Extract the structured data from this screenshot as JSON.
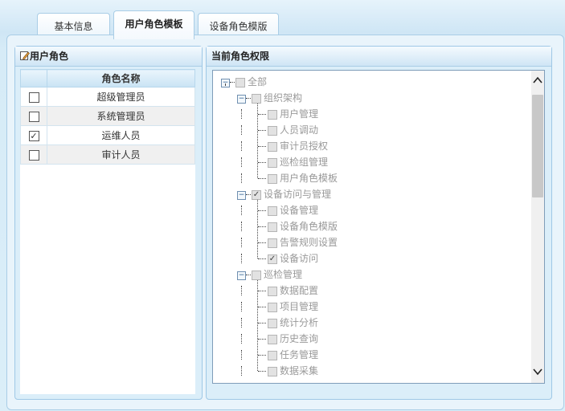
{
  "tabs": [
    {
      "label": "基本信息"
    },
    {
      "label": "用户角色模板"
    },
    {
      "label": "设备角色模版"
    }
  ],
  "left_panel": {
    "title": "用户角色",
    "column": "角色名称",
    "rows": [
      {
        "name": "超级管理员",
        "checked": false
      },
      {
        "name": "系统管理员",
        "checked": false
      },
      {
        "name": "运维人员",
        "checked": true
      },
      {
        "name": "审计人员",
        "checked": false
      }
    ]
  },
  "right_panel": {
    "title": "当前角色权限",
    "tree": {
      "root": "全部",
      "groups": [
        {
          "label": "组织架构",
          "checked": false,
          "children": [
            {
              "label": "用户管理",
              "checked": false
            },
            {
              "label": "人员调动",
              "checked": false
            },
            {
              "label": "审计员授权",
              "checked": false
            },
            {
              "label": "巡检组管理",
              "checked": false
            },
            {
              "label": "用户角色模板",
              "checked": false
            }
          ]
        },
        {
          "label": "设备访问与管理",
          "checked": true,
          "children": [
            {
              "label": "设备管理",
              "checked": false
            },
            {
              "label": "设备角色模版",
              "checked": false
            },
            {
              "label": "告警规则设置",
              "checked": false
            },
            {
              "label": "设备访问",
              "checked": true
            }
          ]
        },
        {
          "label": "巡检管理",
          "checked": false,
          "children": [
            {
              "label": "数据配置",
              "checked": false
            },
            {
              "label": "项目管理",
              "checked": false
            },
            {
              "label": "统计分析",
              "checked": false
            },
            {
              "label": "历史查询",
              "checked": false
            },
            {
              "label": "任务管理",
              "checked": false
            },
            {
              "label": "数据采集",
              "checked": false
            }
          ]
        }
      ]
    }
  },
  "icons": {
    "up": "▲",
    "down": "▼",
    "check": "✓",
    "minus": "−"
  }
}
